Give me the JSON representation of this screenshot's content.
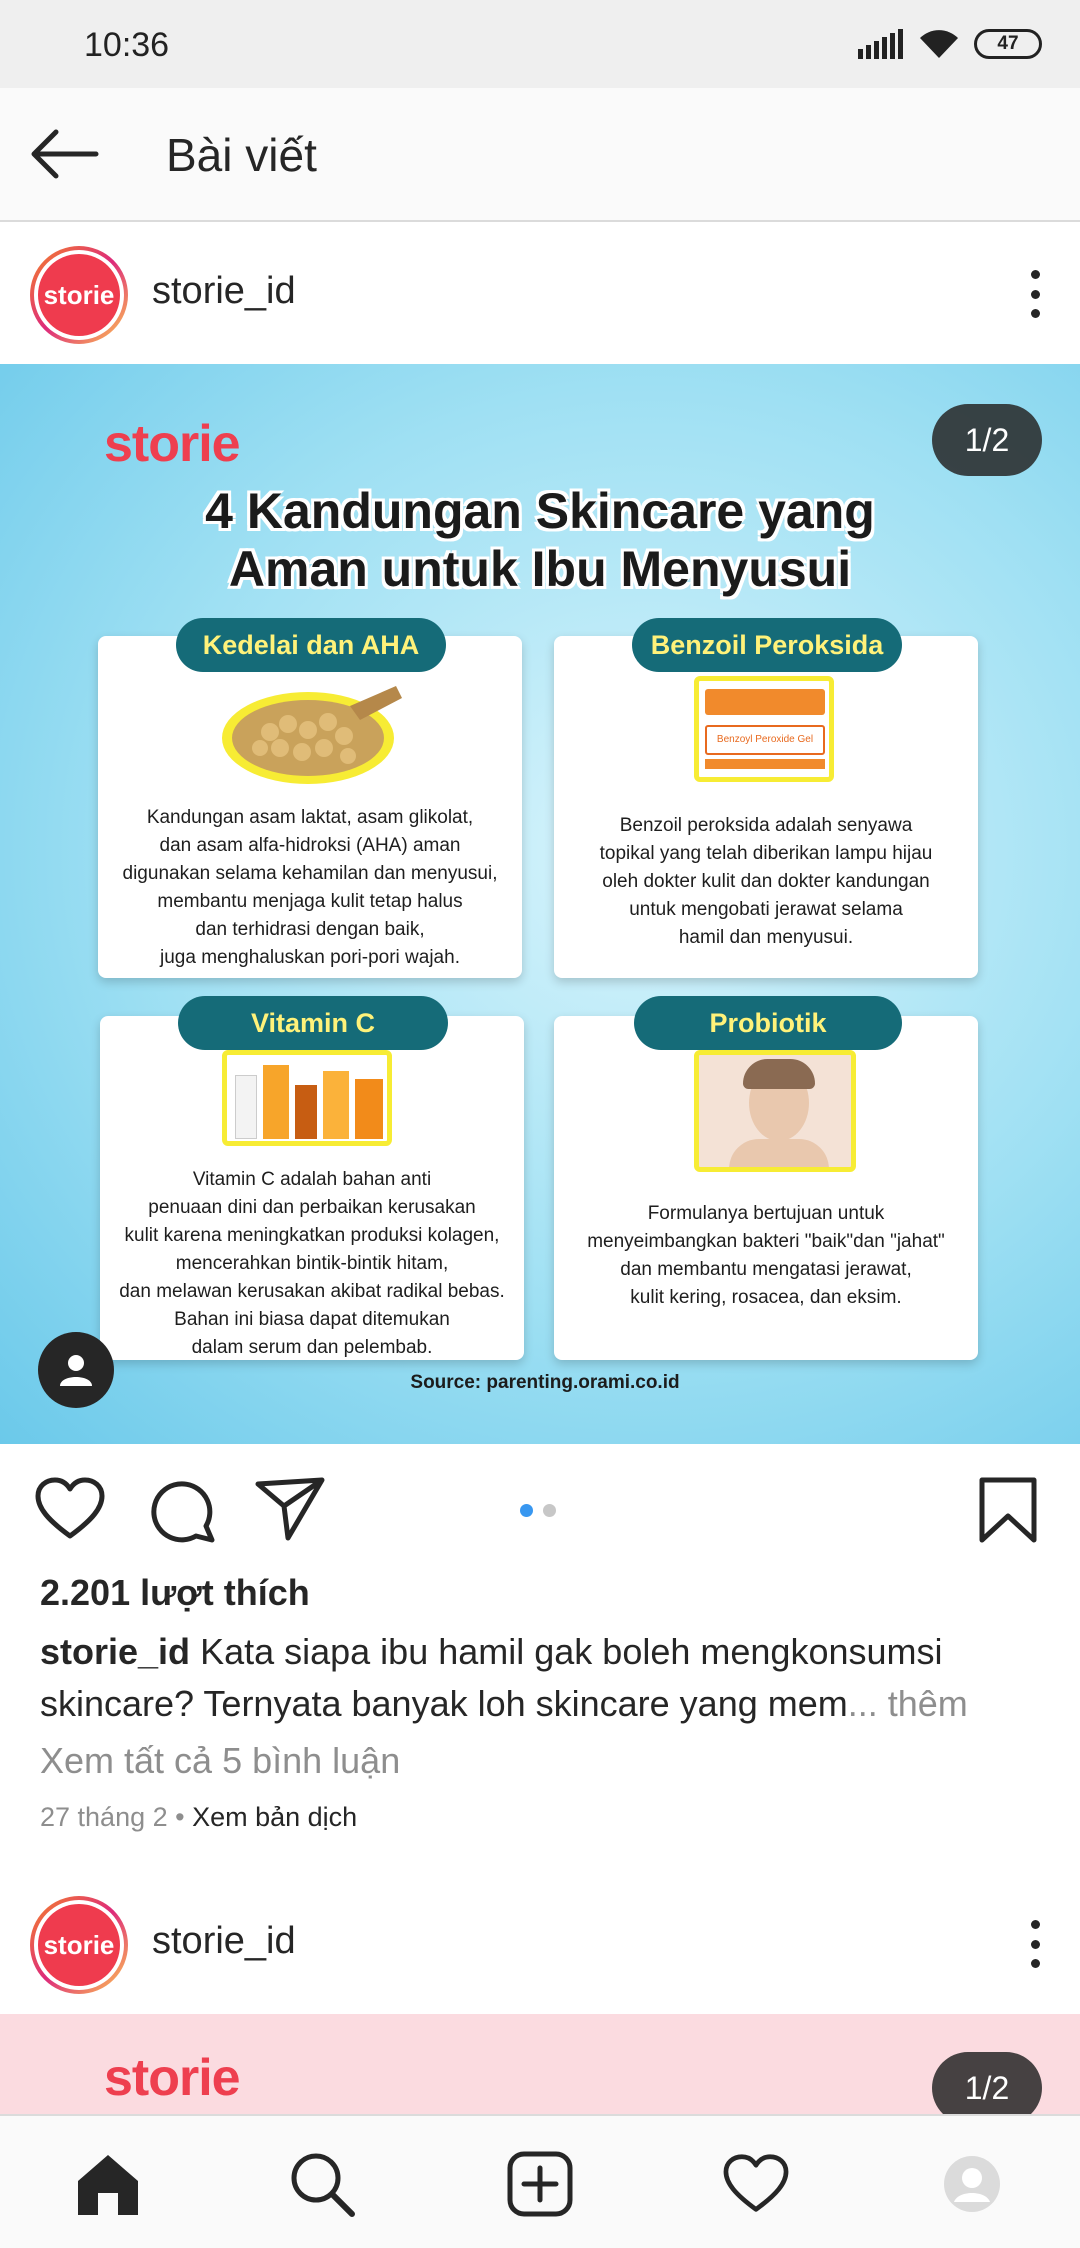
{
  "status_bar": {
    "time": "10:36",
    "battery": "47"
  },
  "app_bar": {
    "title": "Bài viết"
  },
  "post1": {
    "username": "storie_id",
    "avatar_text": "storie",
    "image": {
      "brand": "storie",
      "counter": "1/2",
      "title_line1": "4 Kandungan Skincare yang",
      "title_line2": "Aman untuk Ibu Menyusui",
      "cards": [
        {
          "label": "Kedelai dan AHA",
          "text": [
            "Kandungan asam laktat, asam glikolat,",
            "dan asam alfa-hidroksi (AHA) aman",
            "digunakan selama kehamilan dan menyusui,",
            "membantu menjaga kulit tetap halus",
            "dan terhidrasi dengan baik,",
            "juga menghaluskan pori-pori wajah."
          ]
        },
        {
          "label": "Benzoil Peroksida",
          "text": [
            "Benzoil peroksida adalah senyawa",
            "topikal yang telah diberikan lampu hijau",
            "oleh dokter kulit dan dokter kandungan",
            "untuk mengobati jerawat selama",
            "hamil dan menyusui."
          ],
          "illus_text": "Benzoyl Peroxide Gel"
        },
        {
          "label": "Vitamin C",
          "text": [
            "Vitamin C adalah bahan anti",
            "penuaan dini dan perbaikan kerusakan",
            "kulit karena meningkatkan produksi kolagen,",
            "mencerahkan bintik-bintik hitam,",
            "dan melawan kerusakan akibat radikal bebas.",
            "Bahan ini biasa dapat ditemukan",
            "dalam serum dan pelembab."
          ]
        },
        {
          "label": "Probiotik",
          "text": [
            "Formulanya bertujuan untuk",
            "menyeimbangkan bakteri \"baik\"dan \"jahat\"",
            "dan membantu mengatasi jerawat,",
            "kulit kering, rosacea, dan eksim."
          ]
        }
      ],
      "source": "Source: parenting.orami.co.id"
    },
    "likes": "2.201 lượt thích",
    "caption_user": "storie_id",
    "caption_line1": "Kata siapa ibu hamil gak boleh mengkonsumsi",
    "caption_line2": "skincare? Ternyata banyak loh skincare yang mem",
    "caption_more": "... thêm",
    "view_comments": "Xem tất cả 5 bình luận",
    "date": "27 tháng 2",
    "separator": " • ",
    "translate": "Xem bản dịch"
  },
  "post2": {
    "username": "storie_id",
    "avatar_text": "storie",
    "brand": "storie",
    "counter": "1/2"
  },
  "colors": {
    "accent_blue": "#3897f0",
    "dot_inactive": "#c7c7c7",
    "brand_red": "#ee3f4f",
    "label_teal": "#156b78",
    "label_yellow": "#fff27a"
  },
  "icons": [
    "back-arrow-icon",
    "more-vertical-icon",
    "heart-icon",
    "comment-icon",
    "share-icon",
    "bookmark-icon",
    "home-icon",
    "search-icon",
    "add-icon",
    "activity-icon",
    "profile-icon",
    "tag-user-icon"
  ]
}
